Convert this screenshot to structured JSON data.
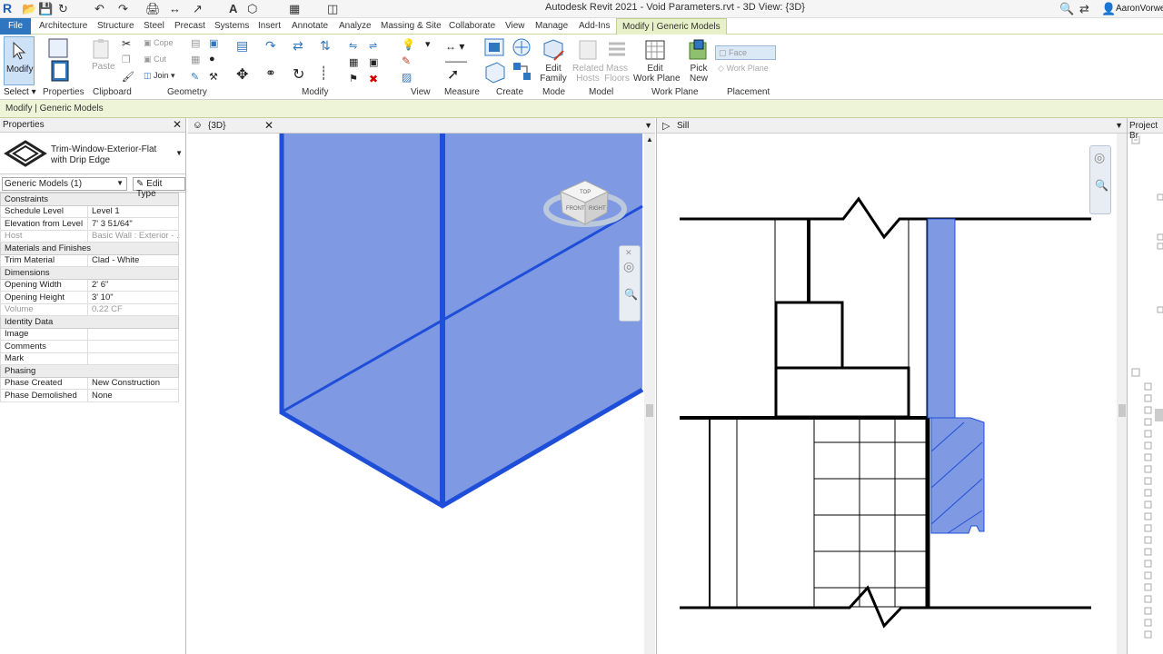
{
  "app": {
    "title": "Autodesk Revit 2021 - Void Parameters.rvt - 3D View: {3D}",
    "user": "AaronVorwerk",
    "logo": "R"
  },
  "ribbon_tabs": [
    "File",
    "Architecture",
    "Structure",
    "Steel",
    "Precast",
    "Systems",
    "Insert",
    "Annotate",
    "Analyze",
    "Massing & Site",
    "Collaborate",
    "View",
    "Manage",
    "Add-Ins",
    "Modify | Generic Models"
  ],
  "ribbon": {
    "select": {
      "label": "Select"
    },
    "modify": {
      "label": "Modify"
    },
    "properties": {
      "label": "Properties"
    },
    "clipboard": {
      "label": "Clipboard",
      "paste": "Paste"
    },
    "geometry": {
      "label": "Geometry",
      "cope": "Cope",
      "cut": "Cut",
      "join": "Join"
    },
    "modify_group": {
      "label": "Modify"
    },
    "view": {
      "label": "View"
    },
    "measure": {
      "label": "Measure"
    },
    "create": {
      "label": "Create"
    },
    "mode": {
      "label": "Mode",
      "edit_family": "Edit\nFamily"
    },
    "model": {
      "label": "Model",
      "related_hosts": "Related\nHosts",
      "mass_floors": "Mass\nFloors"
    },
    "work_plane": {
      "label": "Work Plane",
      "edit_work_plane": "Edit\nWork Plane"
    },
    "placement": {
      "label": "Placement",
      "pick_new": "Pick\nNew",
      "face": "Face",
      "work_plane": "Work Plane"
    }
  },
  "context_bar": {
    "text": "Modify | Generic Models"
  },
  "properties": {
    "title": "Properties",
    "type_name_line1": "Trim-Window-Exterior-Flat",
    "type_name_line2": "with Drip Edge",
    "filter": "Generic Models (1)",
    "edit_type": "Edit Type",
    "sections": [
      {
        "name": "Constraints",
        "rows": [
          {
            "k": "Schedule Level",
            "v": "Level 1",
            "disabled": false
          },
          {
            "k": "Elevation from Level",
            "v": "7'  3 51/64\"",
            "disabled": false
          },
          {
            "k": "Host",
            "v": "Basic Wall : Exterior - ...",
            "disabled": true
          }
        ]
      },
      {
        "name": "Materials and Finishes",
        "rows": [
          {
            "k": "Trim Material",
            "v": "Clad - White",
            "disabled": false
          }
        ]
      },
      {
        "name": "Dimensions",
        "rows": [
          {
            "k": "Opening Width",
            "v": "2'  6\"",
            "disabled": false
          },
          {
            "k": "Opening Height",
            "v": "3'  10\"",
            "disabled": false
          },
          {
            "k": "Volume",
            "v": "0.22 CF",
            "disabled": true
          }
        ]
      },
      {
        "name": "Identity Data",
        "rows": [
          {
            "k": "Image",
            "v": "",
            "disabled": false
          },
          {
            "k": "Comments",
            "v": "",
            "disabled": false
          },
          {
            "k": "Mark",
            "v": "",
            "disabled": false
          }
        ]
      },
      {
        "name": "Phasing",
        "rows": [
          {
            "k": "Phase Created",
            "v": "New Construction",
            "disabled": false
          },
          {
            "k": "Phase Demolished",
            "v": "None",
            "disabled": false
          }
        ]
      }
    ]
  },
  "views": {
    "view3d": {
      "tab": "{3D}"
    },
    "sill": {
      "tab": "Sill"
    }
  },
  "viewcube": {
    "front": "FRONT",
    "right": "RIGHT",
    "top": "TOP"
  },
  "browser": {
    "title": "Project Br"
  },
  "colors": {
    "accent": "#2f76c0",
    "selection": "#1f4fd8",
    "selection_fill": "#7f9ae3",
    "context": "#eef4d8"
  }
}
